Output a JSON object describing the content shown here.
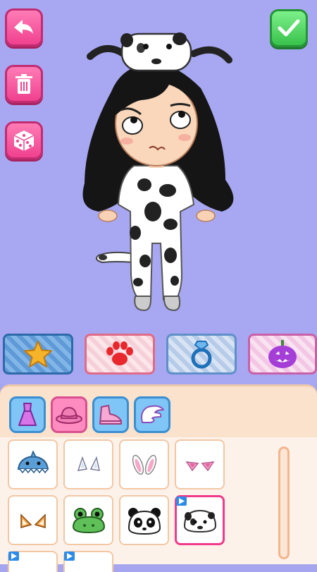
{
  "colors": {
    "background": "#a8a8f2",
    "pink_button": "#f0418f",
    "green_button": "#39c24c",
    "panel": "#fbe2cd",
    "selected_border": "#ef3b8a",
    "ad_badge": "#2d8be8"
  },
  "top_controls": {
    "back": {
      "icon": "back-arrow-icon"
    },
    "delete": {
      "icon": "trash-icon"
    },
    "randomize": {
      "icon": "dice-icon"
    },
    "confirm": {
      "icon": "checkmark-icon"
    }
  },
  "categories": [
    {
      "icon": "star-icon",
      "pattern": "blue-plaid",
      "selected": true
    },
    {
      "icon": "paw-icon",
      "pattern": "pink-plaid",
      "selected": false
    },
    {
      "icon": "ring-icon",
      "pattern": "blue-plaid",
      "selected": false
    },
    {
      "icon": "pumpkin-icon",
      "pattern": "pink-plaid",
      "selected": false
    }
  ],
  "subcategories": [
    {
      "icon": "dress-icon",
      "selected": false
    },
    {
      "icon": "hat-icon",
      "selected": true
    },
    {
      "icon": "shoe-icon",
      "selected": false
    },
    {
      "icon": "wing-icon",
      "selected": false
    }
  ],
  "items": [
    {
      "icon": "shark-hat-icon",
      "ad": false,
      "selected": false
    },
    {
      "icon": "white-ears-icon",
      "ad": false,
      "selected": false
    },
    {
      "icon": "bunny-ears-icon",
      "ad": false,
      "selected": false
    },
    {
      "icon": "cat-ears-icon",
      "ad": false,
      "selected": false
    },
    {
      "icon": "fox-ears-icon",
      "ad": false,
      "selected": false
    },
    {
      "icon": "frog-hat-icon",
      "ad": false,
      "selected": false
    },
    {
      "icon": "panda-hat-icon",
      "ad": false,
      "selected": false
    },
    {
      "icon": "dalmatian-hat-icon",
      "ad": true,
      "selected": true
    },
    {
      "icon": "item-9-icon",
      "ad": true,
      "selected": false
    },
    {
      "icon": "item-10-icon",
      "ad": true,
      "selected": false
    }
  ]
}
